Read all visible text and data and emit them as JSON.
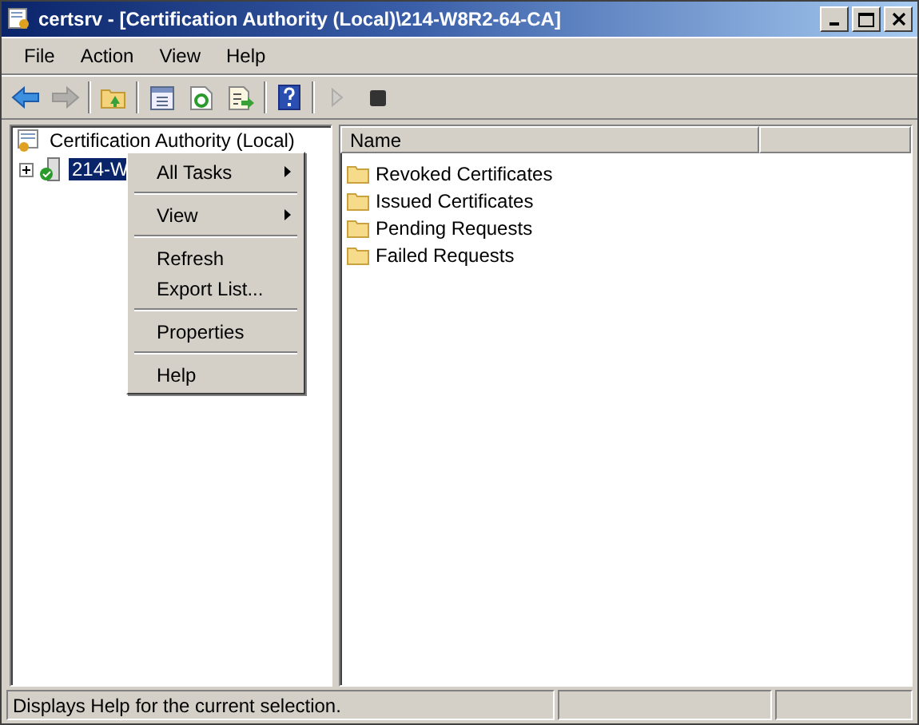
{
  "window": {
    "title": "certsrv - [Certification Authority (Local)\\214-W8R2-64-CA]"
  },
  "menu_bar": [
    "File",
    "Action",
    "View",
    "Help"
  ],
  "toolbar": [
    {
      "kind": "back",
      "disabled": false
    },
    {
      "kind": "forward",
      "disabled": true
    },
    {
      "kind": "sep"
    },
    {
      "kind": "up",
      "disabled": false
    },
    {
      "kind": "sep"
    },
    {
      "kind": "tree",
      "disabled": false
    },
    {
      "kind": "refresh",
      "disabled": false
    },
    {
      "kind": "export",
      "disabled": false
    },
    {
      "kind": "sep"
    },
    {
      "kind": "help",
      "disabled": false
    },
    {
      "kind": "sep"
    },
    {
      "kind": "play",
      "disabled": true
    },
    {
      "kind": "stop",
      "disabled": false
    }
  ],
  "tree": {
    "label": "Certification Authority (Local)",
    "children": [
      {
        "label": "214-W",
        "selected": true,
        "expanded": false
      }
    ]
  },
  "context_menu": [
    {
      "kind": "item",
      "label": "All Tasks",
      "submenu": true
    },
    {
      "kind": "separator"
    },
    {
      "kind": "item",
      "label": "View",
      "submenu": true
    },
    {
      "kind": "separator"
    },
    {
      "kind": "item",
      "label": "Refresh",
      "submenu": false
    },
    {
      "kind": "item",
      "label": "Export List...",
      "submenu": false
    },
    {
      "kind": "separator"
    },
    {
      "kind": "item",
      "label": "Properties",
      "submenu": false
    },
    {
      "kind": "separator"
    },
    {
      "kind": "item",
      "label": "Help",
      "submenu": false
    }
  ],
  "list": {
    "columns": [
      "Name"
    ],
    "rows": [
      "Revoked Certificates",
      "Issued Certificates",
      "Pending Requests",
      "Failed Requests"
    ]
  },
  "status_bar": "Displays Help for the current selection."
}
